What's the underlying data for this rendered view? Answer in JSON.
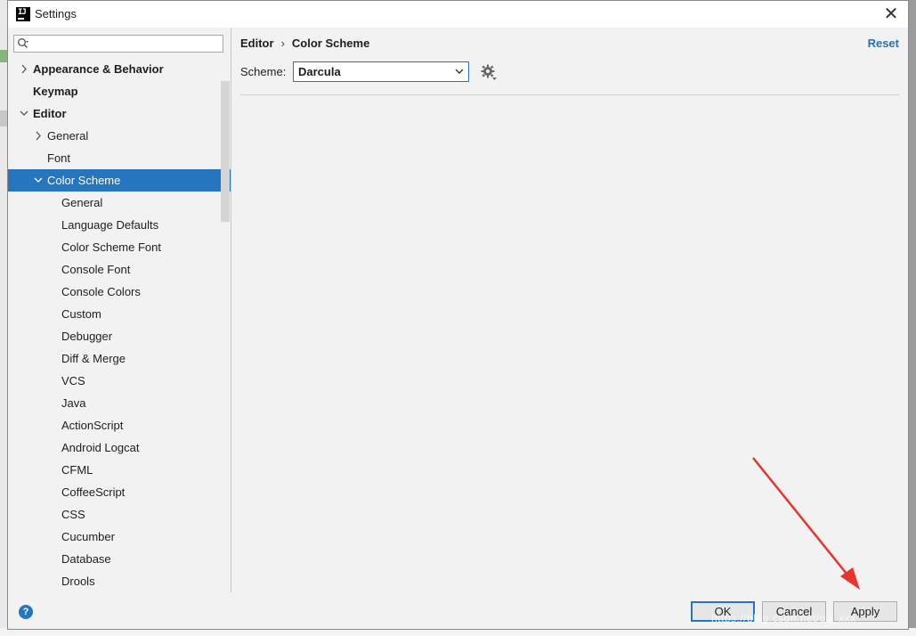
{
  "window": {
    "title": "Settings"
  },
  "search": {
    "placeholder": ""
  },
  "tree": [
    {
      "label": "Appearance & Behavior",
      "level": 0,
      "bold": true,
      "arrow": "right",
      "selected": false
    },
    {
      "label": "Keymap",
      "level": 0,
      "bold": true,
      "arrow": "none",
      "selected": false
    },
    {
      "label": "Editor",
      "level": 0,
      "bold": true,
      "arrow": "down",
      "selected": false
    },
    {
      "label": "General",
      "level": 1,
      "bold": false,
      "arrow": "right",
      "selected": false
    },
    {
      "label": "Font",
      "level": 1,
      "bold": false,
      "arrow": "none",
      "selected": false
    },
    {
      "label": "Color Scheme",
      "level": 1,
      "bold": false,
      "arrow": "down",
      "selected": true
    },
    {
      "label": "General",
      "level": 2,
      "bold": false,
      "arrow": "none",
      "selected": false
    },
    {
      "label": "Language Defaults",
      "level": 2,
      "bold": false,
      "arrow": "none",
      "selected": false
    },
    {
      "label": "Color Scheme Font",
      "level": 2,
      "bold": false,
      "arrow": "none",
      "selected": false
    },
    {
      "label": "Console Font",
      "level": 2,
      "bold": false,
      "arrow": "none",
      "selected": false
    },
    {
      "label": "Console Colors",
      "level": 2,
      "bold": false,
      "arrow": "none",
      "selected": false
    },
    {
      "label": "Custom",
      "level": 2,
      "bold": false,
      "arrow": "none",
      "selected": false
    },
    {
      "label": "Debugger",
      "level": 2,
      "bold": false,
      "arrow": "none",
      "selected": false
    },
    {
      "label": "Diff & Merge",
      "level": 2,
      "bold": false,
      "arrow": "none",
      "selected": false
    },
    {
      "label": "VCS",
      "level": 2,
      "bold": false,
      "arrow": "none",
      "selected": false
    },
    {
      "label": "Java",
      "level": 2,
      "bold": false,
      "arrow": "none",
      "selected": false
    },
    {
      "label": "ActionScript",
      "level": 2,
      "bold": false,
      "arrow": "none",
      "selected": false
    },
    {
      "label": "Android Logcat",
      "level": 2,
      "bold": false,
      "arrow": "none",
      "selected": false
    },
    {
      "label": "CFML",
      "level": 2,
      "bold": false,
      "arrow": "none",
      "selected": false
    },
    {
      "label": "CoffeeScript",
      "level": 2,
      "bold": false,
      "arrow": "none",
      "selected": false
    },
    {
      "label": "CSS",
      "level": 2,
      "bold": false,
      "arrow": "none",
      "selected": false
    },
    {
      "label": "Cucumber",
      "level": 2,
      "bold": false,
      "arrow": "none",
      "selected": false
    },
    {
      "label": "Database",
      "level": 2,
      "bold": false,
      "arrow": "none",
      "selected": false
    },
    {
      "label": "Drools",
      "level": 2,
      "bold": false,
      "arrow": "none",
      "selected": false
    }
  ],
  "breadcrumb": {
    "parent": "Editor",
    "separator": "›",
    "current": "Color Scheme"
  },
  "reset_label": "Reset",
  "scheme": {
    "label": "Scheme:",
    "value": "Darcula"
  },
  "buttons": {
    "help": "?",
    "ok": "OK",
    "cancel": "Cancel",
    "apply": "Apply"
  },
  "watermark": "https://blog.csdn.net/qq_xxx",
  "colors": {
    "accent": "#2675bf",
    "annotation": "#e8352b",
    "link": "#2a6ebb"
  }
}
